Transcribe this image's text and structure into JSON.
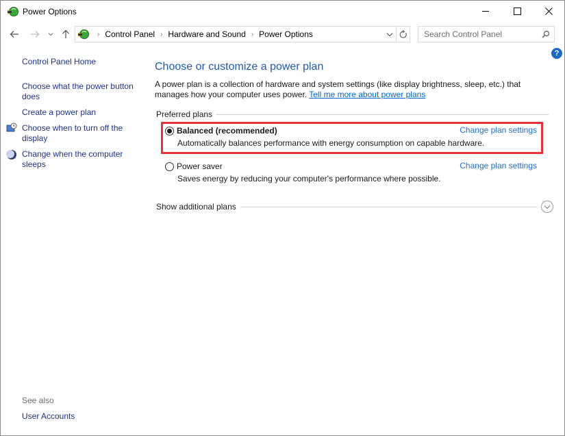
{
  "window": {
    "title": "Power Options",
    "controls": {
      "minimize": "minimize",
      "maximize": "maximize",
      "close": "close"
    }
  },
  "nav": {
    "breadcrumbs": [
      "Control Panel",
      "Hardware and Sound",
      "Power Options"
    ],
    "search_placeholder": "Search Control Panel"
  },
  "sidebar": {
    "home": "Control Panel Home",
    "links": [
      {
        "label": "Choose what the power button does",
        "icon": "none"
      },
      {
        "label": "Create a power plan",
        "icon": "none"
      },
      {
        "label": "Choose when to turn off the display",
        "icon": "display-clock-icon"
      },
      {
        "label": "Change when the computer sleeps",
        "icon": "moon-icon"
      }
    ],
    "see_also_label": "See also",
    "see_also_links": [
      "User Accounts"
    ]
  },
  "main": {
    "title": "Choose or customize a power plan",
    "intro_text": "A power plan is a collection of hardware and system settings (like display brightness, sleep, etc.) that manages how your computer uses power. ",
    "intro_link": "Tell me more about power plans",
    "preferred_label": "Preferred plans",
    "plans": [
      {
        "name": "Balanced (recommended)",
        "description": "Automatically balances performance with energy consumption on capable hardware.",
        "selected": true,
        "change_link": "Change plan settings"
      },
      {
        "name": "Power saver",
        "description": "Saves energy by reducing your computer's performance where possible.",
        "selected": false,
        "change_link": "Change plan settings"
      }
    ],
    "additional_label": "Show additional plans"
  },
  "colors": {
    "highlight": "#e8313a",
    "link": "#1e6fcc",
    "title": "#1e5aaf",
    "sidebar_link": "#1e3287"
  }
}
